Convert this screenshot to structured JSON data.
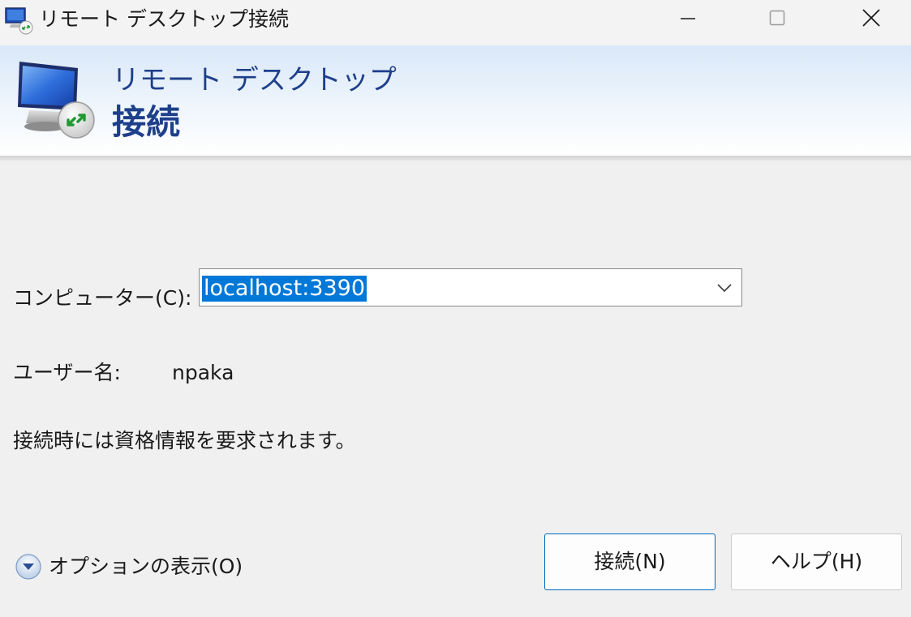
{
  "window": {
    "title": "リモート デスクトップ接続",
    "icon": "remote-desktop-icon"
  },
  "banner": {
    "line1": "リモート デスクトップ",
    "line2": "接続"
  },
  "form": {
    "computer_label": "コンピューター(C):",
    "computer_value": "localhost:3390",
    "username_label": "ユーザー名:",
    "username_value": "npaka",
    "credentials_note": "接続時には資格情報を要求されます。"
  },
  "footer": {
    "options_label": "オプションの表示(O)",
    "connect_button": "接続(N)",
    "help_button": "ヘルプ(H)"
  },
  "colors": {
    "accent": "#0078d7",
    "banner_text": "#1e3f8a",
    "selection": "#0078d7"
  }
}
